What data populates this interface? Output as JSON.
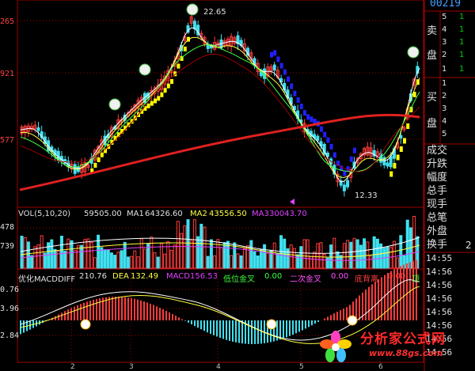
{
  "colors": {
    "up": "#ff3c3c",
    "down": "#40e0f0",
    "bg": "#000000",
    "grid": "#a00000",
    "ma_long": "#e02020",
    "ma_mid": "#a00000",
    "yellow": "#ffff00",
    "blue": "#2020ff",
    "white": "#ffffff"
  },
  "price_panel": {
    "y_labels": [
      "265",
      "921",
      "577"
    ],
    "annotations": {
      "high": "22.65",
      "low": "12.33"
    }
  },
  "volume_panel": {
    "header": {
      "title": "VOL(5,10,20)",
      "vol": "59505.00",
      "ma1_label": "MA1",
      "ma1": "64326.60",
      "ma2_label": "MA2",
      "ma2": "43556.50",
      "ma3_label": "MA3",
      "ma3": "30043.70"
    },
    "y_labels": [
      "478",
      "739"
    ]
  },
  "macd_panel": {
    "header": {
      "name": "优化MACDDIFF",
      "diff": "210.76",
      "dea_label": "DEA",
      "dea": "132.49",
      "macd_label": "MACD",
      "macd": "156.53",
      "low_cross_label": "低位金叉",
      "low_cross": "0.00",
      "second_cross_label": "二次金叉",
      "second_cross": "0.00",
      "divergence_label": "底背离",
      "divergence": "0.00",
      "top_label": "顶"
    },
    "y_labels": [
      "0.76",
      "3.96",
      "2.84"
    ]
  },
  "x_labels": [
    "2",
    "3",
    "4",
    "5",
    "6"
  ],
  "side_panel": {
    "code": "00219",
    "sell_label_1": "卖",
    "sell_label_2": "盘",
    "buy_label_1": "买",
    "buy_label_2": "盘",
    "sell_levels": [
      "5",
      "4",
      "3",
      "2",
      "1"
    ],
    "buy_levels": [
      "1",
      "2",
      "3",
      "4",
      "5"
    ],
    "sell_values": [
      "1",
      "1",
      "1",
      "1",
      "1"
    ],
    "fields": [
      "成交",
      "升跌",
      "幅度",
      "总手",
      "现手",
      "总笔",
      "外盘",
      "换手"
    ],
    "side_value": "2",
    "times": [
      "14:55",
      "14:56",
      "14:56",
      "14:56",
      "14:56",
      "14:56",
      "14:56",
      "14:56"
    ]
  },
  "watermark": {
    "title": "分析家公式网",
    "url": "www.88gs.com"
  }
}
